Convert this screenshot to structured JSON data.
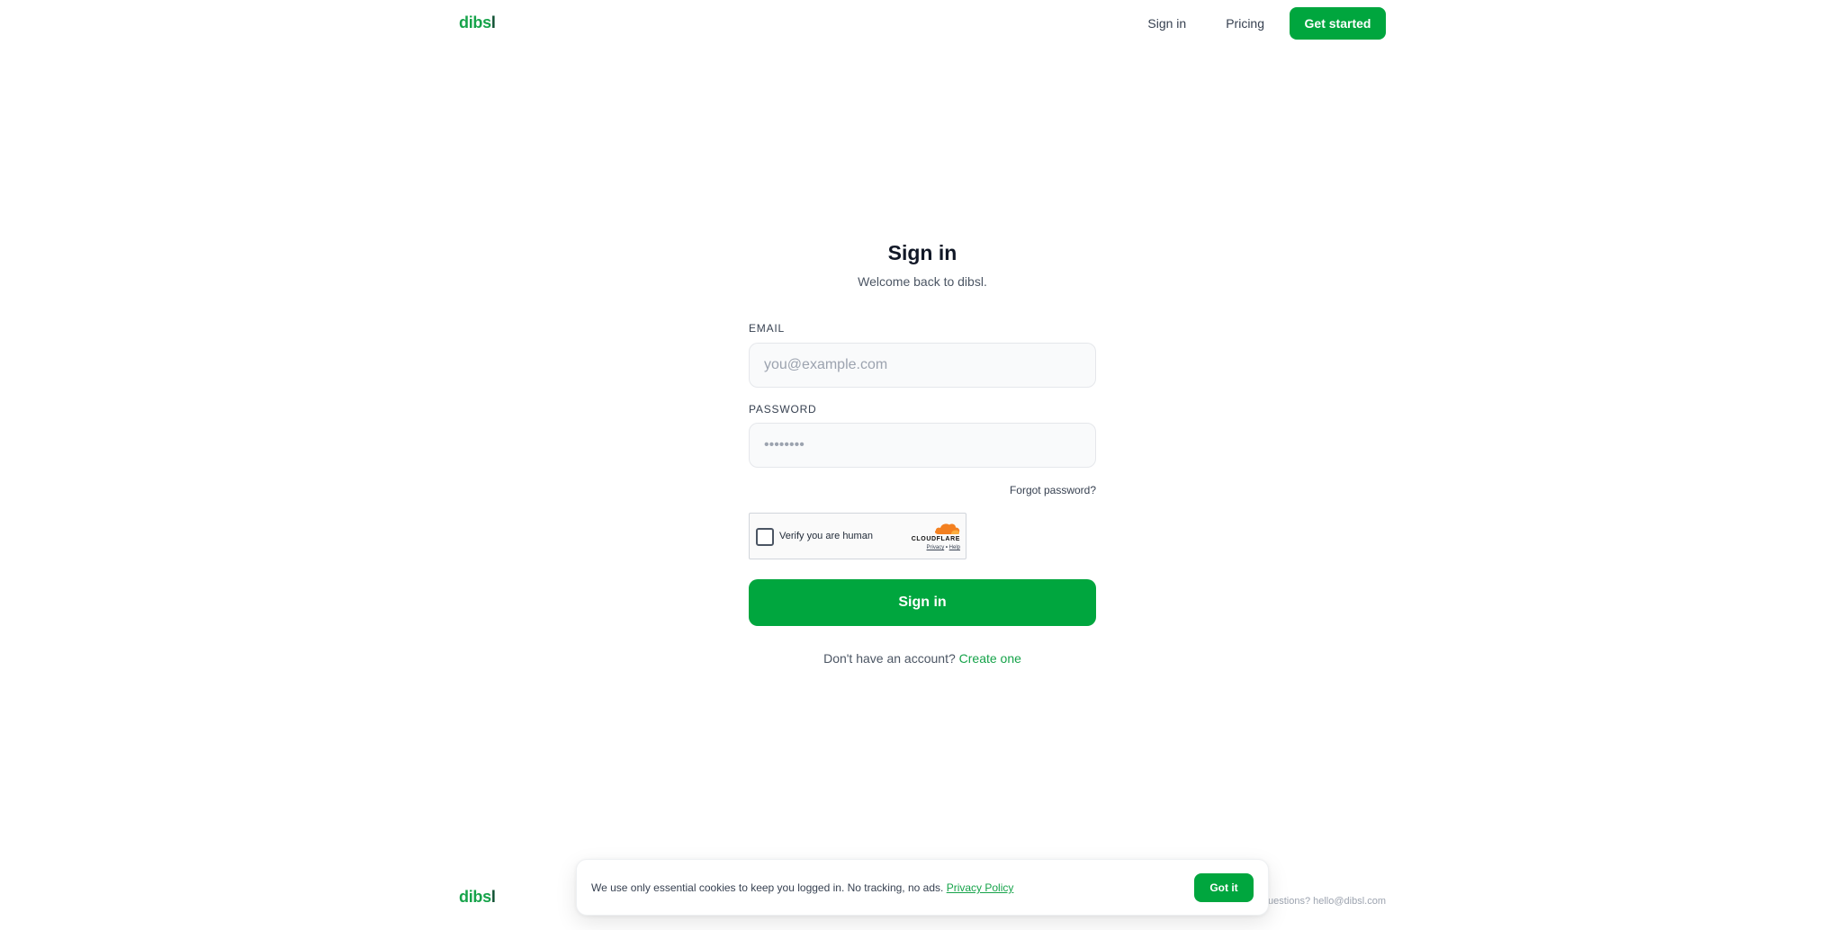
{
  "brand": {
    "logo_prefix": "dibs",
    "logo_suffix": "l",
    "color": "#00a63e"
  },
  "nav": {
    "signin": "Sign in",
    "pricing": "Pricing",
    "get_started": "Get started"
  },
  "form": {
    "title": "Sign in",
    "subtitle": "Welcome back to dibsl.",
    "email_label": "EMAIL",
    "email_placeholder": "you@example.com",
    "password_label": "PASSWORD",
    "password_placeholder": "••••••••",
    "forgot": "Forgot password?",
    "submit": "Sign in",
    "signup_prompt": "Don't have an account?",
    "signup_link": "Create one"
  },
  "captcha": {
    "label": "Verify you are human",
    "provider": "CLOUDFLARE",
    "privacy": "Privacy",
    "separator": "•",
    "help": "Help",
    "icon": "cloudflare-icon"
  },
  "footer": {
    "contact": "Questions? hello@dibsl.com"
  },
  "cookie": {
    "text": "We use only essential cookies to keep you logged in. No tracking, no ads.",
    "policy_link": "Privacy Policy",
    "accept": "Got it"
  }
}
